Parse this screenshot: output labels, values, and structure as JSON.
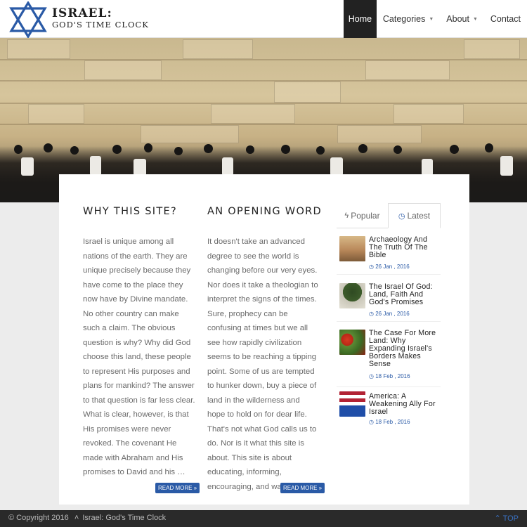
{
  "header": {
    "logo_line1": "ISRAEL:",
    "logo_line2": "GOD'S TIME CLOCK",
    "nav": [
      {
        "label": "Home"
      },
      {
        "label": "Categories"
      },
      {
        "label": "About"
      },
      {
        "label": "Contact"
      }
    ]
  },
  "articles": [
    {
      "title": "WHY THIS SITE?",
      "body": "Israel is unique among all nations of the earth. They are unique precisely because they have come to the place they now have by Divine mandate. No other country can make such a claim. The obvious question is why? Why did God choose this land, these people to represent His purposes and plans for mankind? The answer to that question is far less clear. What is clear, however, is that His promises were never revoked. The covenant He made with Abraham and His promises to David and his …",
      "read_more": "READ MORE »"
    },
    {
      "title": "AN OPENING WORD",
      "body": "It doesn't take an advanced degree to see the world is changing before our very eyes. Nor does it take a theologian to interpret the signs of the times. Sure, prophecy can be confusing at times but we all see how rapidly civilization seems to be reaching a tipping point. Some of us are tempted to hunker down, buy a piece of land in the wilderness and hope to hold on for dear life. That's not what God calls us to do. Nor is it what this site is about. This site is about educating, informing, encouraging, and warning.",
      "read_more": "READ MORE »"
    }
  ],
  "sidebar": {
    "tabs": [
      {
        "label": "Popular",
        "icon": "bolt-icon"
      },
      {
        "label": "Latest",
        "icon": "clock-icon"
      }
    ],
    "posts": [
      {
        "title": "Archaeology And The Truth Of The Bible",
        "date": "26 Jan , 2016"
      },
      {
        "title": "The Israel Of God: Land, Faith And God's Promises",
        "date": "26 Jan , 2016"
      },
      {
        "title": "The Case For More Land: Why Expanding Israel's Borders Makes Sense",
        "date": "18 Feb , 2016"
      },
      {
        "title": "America: A Weakening Ally For Israel",
        "date": "18 Feb , 2016"
      }
    ]
  },
  "footer": {
    "copyright": "© Copyright 2016",
    "site_link": "Israel: God's Time Clock",
    "top_label": "TOP"
  },
  "colors": {
    "accent": "#2a5aa6",
    "nav_active": "#222222",
    "footer": "#2a2a2a"
  }
}
